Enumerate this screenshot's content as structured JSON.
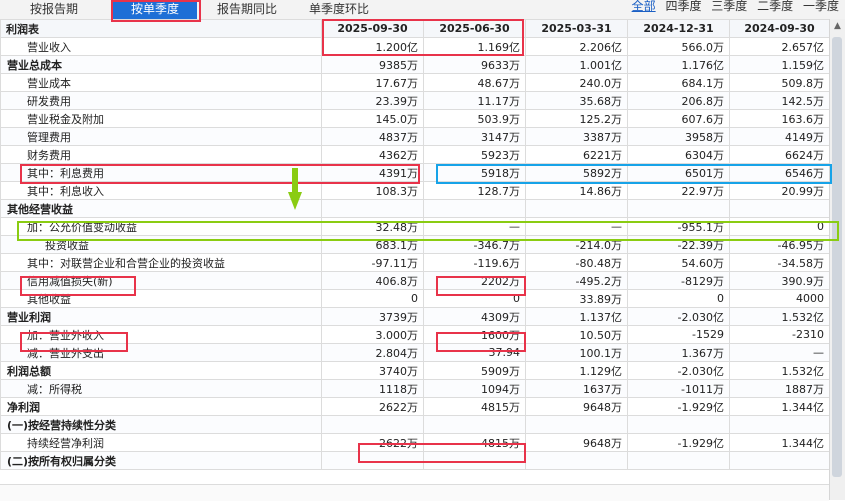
{
  "tabs": {
    "items": [
      {
        "label": "按报告期",
        "active": false
      },
      {
        "label": "按单季度",
        "active": true
      },
      {
        "label": "报告期同比",
        "active": false
      },
      {
        "label": "单季度环比",
        "active": false
      }
    ],
    "right": [
      "全部",
      "四季度",
      "三季度",
      "二季度",
      "一季度"
    ]
  },
  "table": {
    "corner": "利润表",
    "columns": [
      "2025-09-30",
      "2025-06-30",
      "2025-03-31",
      "2024-12-31",
      "2024-09-30"
    ],
    "rows": [
      {
        "label": "营业收入",
        "indent": 1,
        "values": [
          "1.200亿",
          "1.169亿",
          "2.206亿",
          "566.0万",
          "2.657亿"
        ]
      },
      {
        "label": "营业总成本",
        "indent": 0,
        "bold": true,
        "values": [
          "9385万",
          "9633万",
          "1.001亿",
          "1.176亿",
          "1.159亿"
        ]
      },
      {
        "label": "营业成本",
        "indent": 1,
        "values": [
          "17.67万",
          "48.67万",
          "240.0万",
          "684.1万",
          "509.8万"
        ]
      },
      {
        "label": "研发费用",
        "indent": 1,
        "values": [
          "23.39万",
          "11.17万",
          "35.68万",
          "206.8万",
          "142.5万"
        ]
      },
      {
        "label": "营业税金及附加",
        "indent": 1,
        "values": [
          "145.0万",
          "503.9万",
          "125.2万",
          "607.6万",
          "163.6万"
        ]
      },
      {
        "label": "管理费用",
        "indent": 1,
        "values": [
          "4837万",
          "3147万",
          "3387万",
          "3958万",
          "4149万"
        ]
      },
      {
        "label": "财务费用",
        "indent": 1,
        "values": [
          "4362万",
          "5923万",
          "6221万",
          "6304万",
          "6624万"
        ]
      },
      {
        "label": "其中：利息费用",
        "indent": 1,
        "values": [
          "4391万",
          "5918万",
          "5892万",
          "6501万",
          "6546万"
        ]
      },
      {
        "label": "其中：利息收入",
        "indent": 1,
        "values": [
          "108.3万",
          "128.7万",
          "14.86万",
          "22.97万",
          "20.99万"
        ]
      },
      {
        "label": "其他经营收益",
        "indent": 0,
        "bold": true,
        "values": [
          "",
          "",
          "",
          "",
          ""
        ]
      },
      {
        "label": "加：公允价值变动收益",
        "indent": 1,
        "values": [
          "32.48万",
          "—",
          "—",
          "-955.1万",
          "0"
        ]
      },
      {
        "label": "投资收益",
        "indent": 2,
        "values": [
          "683.1万",
          "-346.7万",
          "-214.0万",
          "-22.39万",
          "-46.95万"
        ]
      },
      {
        "label": "其中：对联营企业和合营企业的投资收益",
        "indent": 1,
        "values": [
          "-97.11万",
          "-119.6万",
          "-80.48万",
          "54.60万",
          "-34.58万"
        ]
      },
      {
        "label": "信用减值损失(新)",
        "indent": 1,
        "values": [
          "406.8万",
          "2202万",
          "-495.2万",
          "-8129万",
          "390.9万"
        ]
      },
      {
        "label": "其他收益",
        "indent": 1,
        "values": [
          "0",
          "0",
          "33.89万",
          "0",
          "4000"
        ]
      },
      {
        "label": "营业利润",
        "indent": 0,
        "bold": true,
        "values": [
          "3739万",
          "4309万",
          "1.137亿",
          "-2.030亿",
          "1.532亿"
        ]
      },
      {
        "label": "加：营业外收入",
        "indent": 1,
        "values": [
          "3.000万",
          "1600万",
          "10.50万",
          "-1529",
          "-2310"
        ]
      },
      {
        "label": "减：营业外支出",
        "indent": 1,
        "values": [
          "2.804万",
          "37.94",
          "100.1万",
          "1.367万",
          "—"
        ]
      },
      {
        "label": "利润总额",
        "indent": 0,
        "bold": true,
        "values": [
          "3740万",
          "5909万",
          "1.129亿",
          "-2.030亿",
          "1.532亿"
        ]
      },
      {
        "label": "减：所得税",
        "indent": 1,
        "values": [
          "1118万",
          "1094万",
          "1637万",
          "-1011万",
          "1887万"
        ]
      },
      {
        "label": "净利润",
        "indent": 0,
        "bold": true,
        "values": [
          "2622万",
          "4815万",
          "9648万",
          "-1.929亿",
          "1.344亿"
        ]
      },
      {
        "label": "(一)按经营持续性分类",
        "indent": 0,
        "bold": true,
        "values": [
          "",
          "",
          "",
          "",
          ""
        ]
      },
      {
        "label": "持续经营净利润",
        "indent": 1,
        "values": [
          "2622万",
          "4815万",
          "9648万",
          "-1.929亿",
          "1.344亿"
        ]
      },
      {
        "label": "(二)按所有权归属分类",
        "indent": 0,
        "bold": true,
        "values": [
          "",
          "",
          "",
          "",
          ""
        ]
      }
    ]
  },
  "colors": {
    "tab_active": "#1e6fd6",
    "highlight_red": "#e8334a",
    "highlight_blue": "#17a3e8",
    "highlight_green": "#8acc12"
  }
}
